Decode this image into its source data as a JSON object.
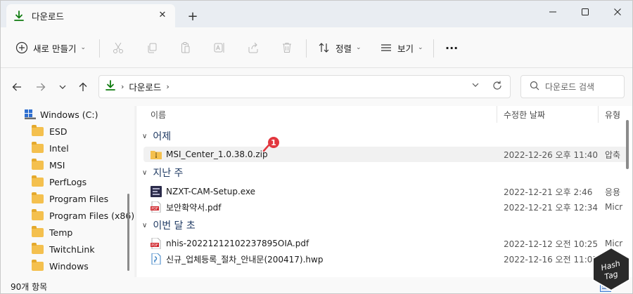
{
  "tab": {
    "title": "다운로드",
    "close": "✕",
    "new_tab": "+"
  },
  "window_controls": {
    "minimize": "—",
    "maximize": "□",
    "close": "✕"
  },
  "toolbar": {
    "new_label": "새로 만들기",
    "sort_label": "정렬",
    "view_label": "보기",
    "more": "···"
  },
  "address": {
    "crumbs": [
      "다운로드"
    ],
    "search_placeholder": "다운로드 검색"
  },
  "sidebar": {
    "items": [
      {
        "label": "Windows (C:)",
        "icon": "drive-icon"
      },
      {
        "label": "ESD",
        "icon": "folder-icon"
      },
      {
        "label": "Intel",
        "icon": "folder-icon"
      },
      {
        "label": "MSI",
        "icon": "folder-icon"
      },
      {
        "label": "PerfLogs",
        "icon": "folder-icon"
      },
      {
        "label": "Program Files",
        "icon": "folder-icon"
      },
      {
        "label": "Program Files (x86)",
        "icon": "folder-icon"
      },
      {
        "label": "Temp",
        "icon": "folder-icon"
      },
      {
        "label": "TwitchLink",
        "icon": "folder-icon"
      },
      {
        "label": "Windows",
        "icon": "folder-icon"
      }
    ]
  },
  "columns": {
    "name": "이름",
    "date": "수정한 날짜",
    "type": "유형"
  },
  "groups": [
    {
      "label": "어제",
      "files": [
        {
          "name": "MSI_Center_1.0.38.0.zip",
          "date": "2022-12-26 오후 11:40",
          "type": "압축",
          "icon": "zip-folder-icon"
        }
      ]
    },
    {
      "label": "지난 주",
      "files": [
        {
          "name": "NZXT-CAM-Setup.exe",
          "date": "2022-12-21 오후 2:46",
          "type": "응용",
          "icon": "exe-icon"
        },
        {
          "name": "보안확약서.pdf",
          "date": "2022-12-21 오후 12:34",
          "type": "Micr",
          "icon": "pdf-icon"
        }
      ]
    },
    {
      "label": "이번 달 초",
      "files": [
        {
          "name": "nhis-20221212102237895OIA.pdf",
          "date": "2022-12-12 오전 10:25",
          "type": "Micr",
          "icon": "pdf-icon"
        },
        {
          "name": "신규_업체등록_절차_안내문(200417).hwp",
          "date": "2022-12-16 오전 11:05",
          "type": "",
          "icon": "hwp-icon"
        }
      ]
    }
  ],
  "annotation": {
    "number": "1"
  },
  "status": {
    "count": "90개 항목"
  },
  "watermark": {
    "text_line1": "Hash",
    "text_line2": "Tag"
  },
  "colors": {
    "accent": "#0f7b0f",
    "badge": "#e2373f",
    "group_text": "#1f3a63"
  }
}
